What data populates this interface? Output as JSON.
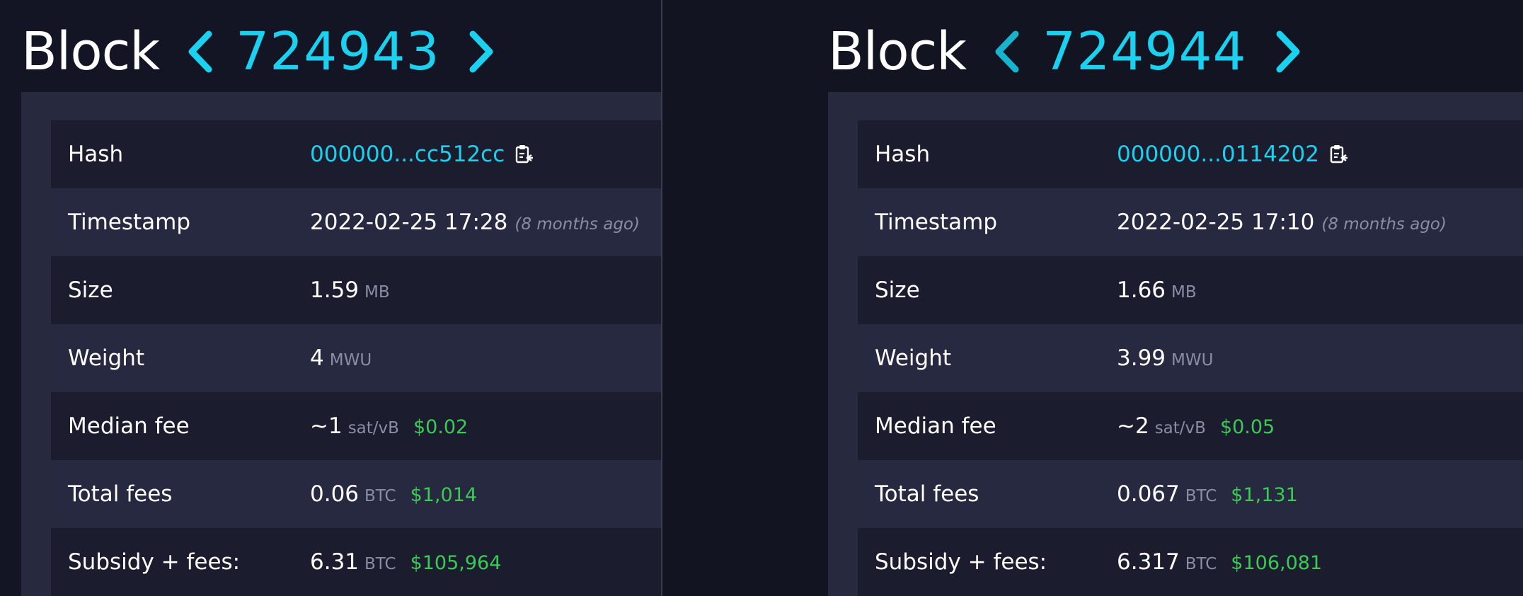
{
  "blocks": [
    {
      "title": "Block",
      "number": "724943",
      "hash": "000000...cc512cc",
      "timestamp": "2022-02-25 17:28",
      "timestamp_ago": "(8 months ago)",
      "size": "1.59",
      "size_unit": "MB",
      "weight": "4",
      "weight_unit": "MWU",
      "median_fee": "~1",
      "median_fee_unit": "sat/vB",
      "median_fee_fiat": "$0.02",
      "total_fees": "0.06",
      "total_fees_unit": "BTC",
      "total_fees_fiat": "$1,014",
      "subsidy_fees": "6.31",
      "subsidy_fees_unit": "BTC",
      "subsidy_fees_fiat": "$105,964"
    },
    {
      "title": "Block",
      "number": "724944",
      "hash": "000000...0114202",
      "timestamp": "2022-02-25 17:10",
      "timestamp_ago": "(8 months ago)",
      "size": "1.66",
      "size_unit": "MB",
      "weight": "3.99",
      "weight_unit": "MWU",
      "median_fee": "~2",
      "median_fee_unit": "sat/vB",
      "median_fee_fiat": "$0.05",
      "total_fees": "0.067",
      "total_fees_unit": "BTC",
      "total_fees_fiat": "$1,131",
      "subsidy_fees": "6.317",
      "subsidy_fees_unit": "BTC",
      "subsidy_fees_fiat": "$106,081"
    }
  ],
  "labels": {
    "hash": "Hash",
    "timestamp": "Timestamp",
    "size": "Size",
    "weight": "Weight",
    "median_fee": "Median fee",
    "total_fees": "Total fees",
    "subsidy_fees": "Subsidy + fees:"
  },
  "icons": {
    "prev": "chevron-left-icon",
    "next": "chevron-right-icon",
    "copy": "clipboard-copy-icon"
  },
  "colors": {
    "accent": "#1bd1f0",
    "fiat": "#3bcb54",
    "muted": "#8a8da3",
    "panel": "#272a3f",
    "row_dark": "#1b1d2f",
    "row_light": "#262940"
  }
}
